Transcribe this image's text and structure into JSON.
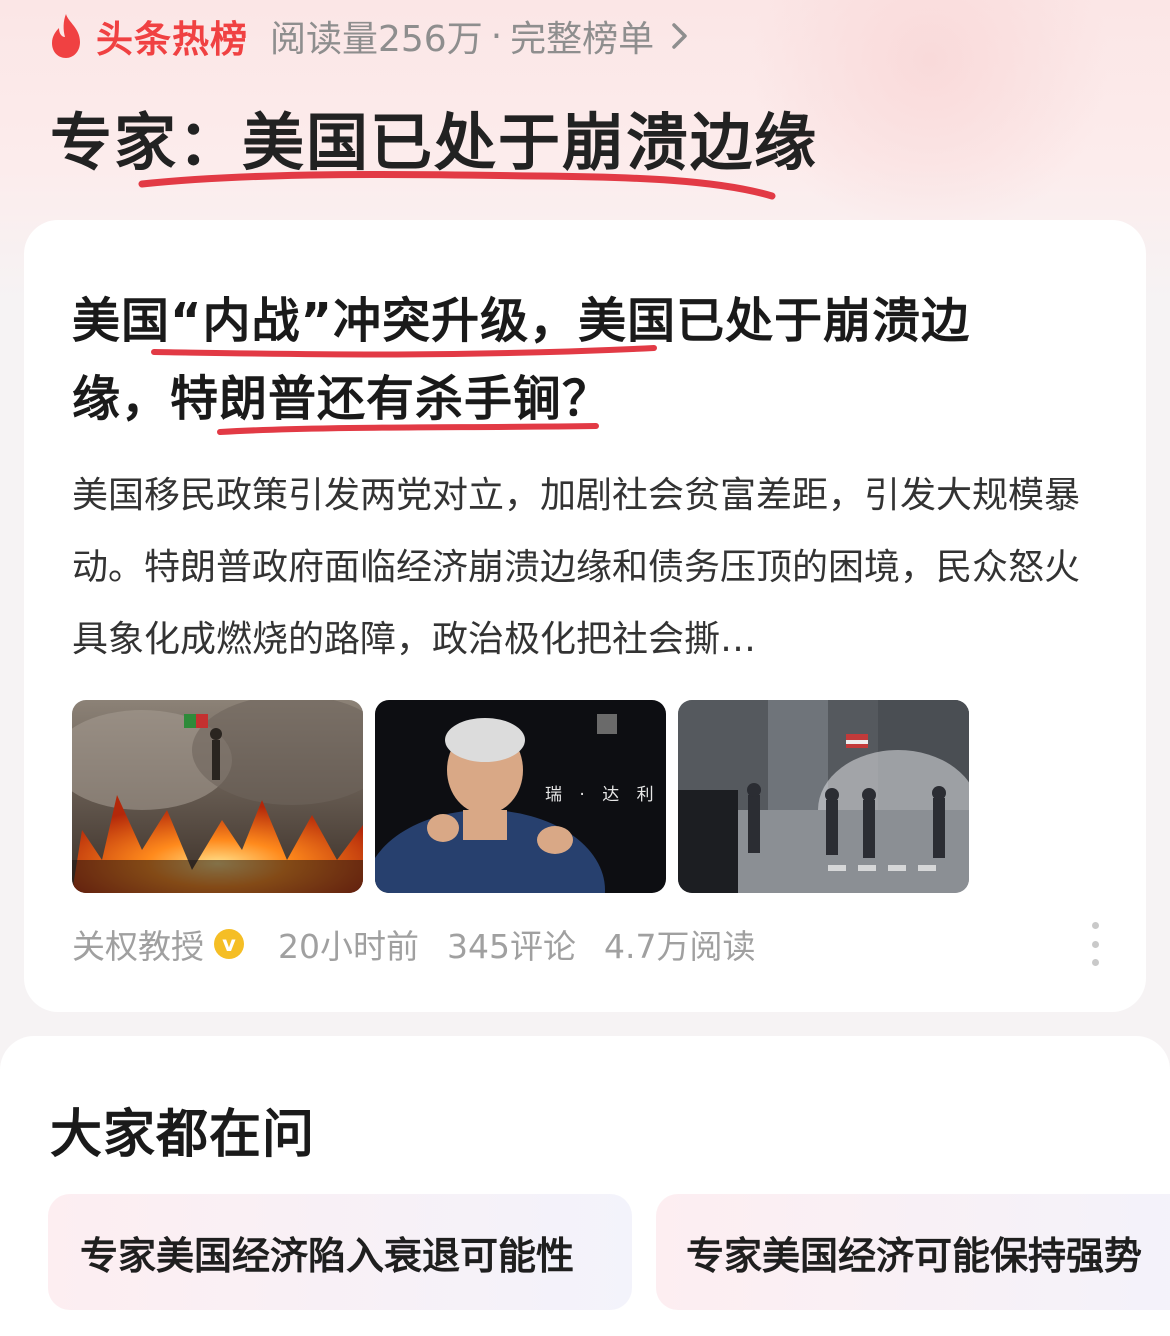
{
  "hotlist": {
    "brand": "头条热榜",
    "reads": "阅读量256万",
    "separator": "·",
    "full_list": "完整榜单",
    "icon": "flame-icon",
    "chevron": "chevron-right-icon",
    "brand_color": "#f04142"
  },
  "topic": {
    "title": "专家：美国已处于崩溃边缘",
    "underline_color": "#e23a45"
  },
  "article": {
    "title_line1": "美国“内战”冲突升级，美国已处于崩溃边",
    "title_line2": "缘，特朗普还有杀手锏？",
    "summary": "美国移民政策引发两党对立，加剧社会贫富差距，引发大规模暴动。特朗普政府面临经济崩溃边缘和债务压顶的困境，民众怒火具象化成燃烧的路障，政治极化把社会撕…",
    "thumbnails": [
      {
        "name": "thumb-fire-protest"
      },
      {
        "name": "thumb-speaker",
        "caption": "瑞 · 达 利"
      },
      {
        "name": "thumb-street-crosswalk"
      }
    ],
    "author": "关权教授",
    "verified_badge": "v",
    "time": "20小时前",
    "comments": "345评论",
    "reads": "4.7万阅读",
    "more_icon": "more-vertical-icon"
  },
  "ask": {
    "title": "大家都在问",
    "chips": [
      "专家美国经济陷入衰退可能性",
      "专家美国经济可能保持强势"
    ]
  }
}
